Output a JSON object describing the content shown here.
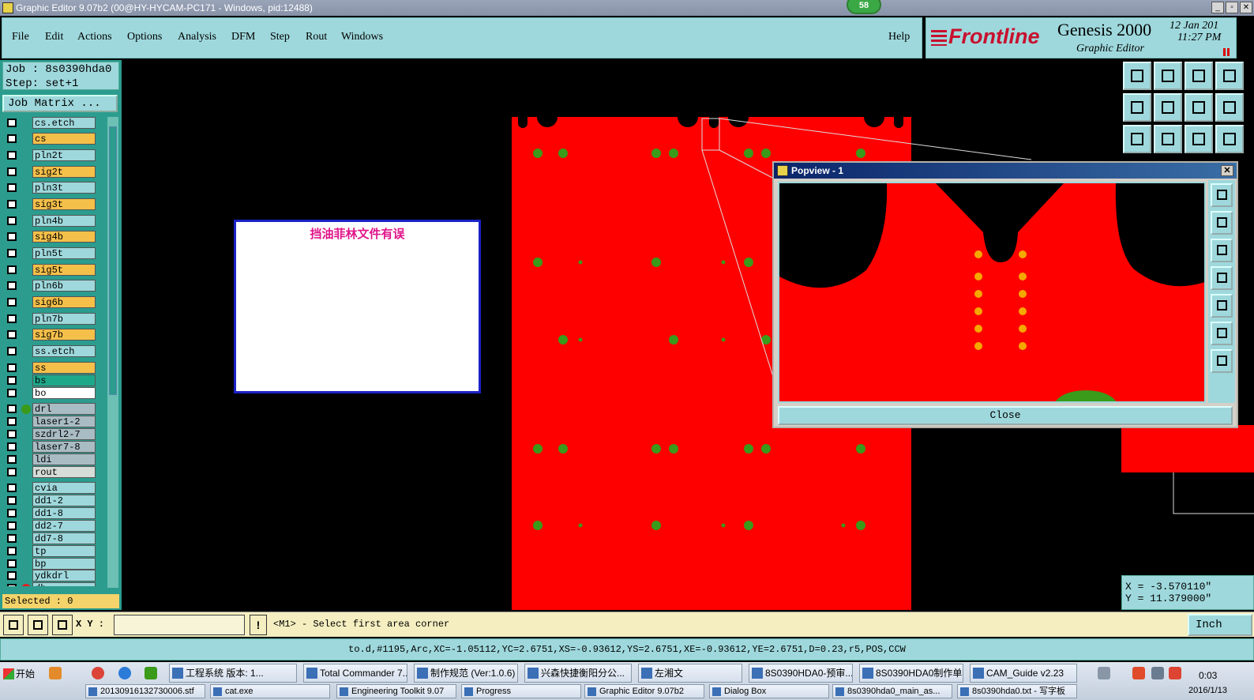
{
  "window": {
    "title": "Graphic Editor 9.07b2 (00@HY-HYCAM-PC171 - Windows, pid:12488)",
    "badge": "58"
  },
  "menu": {
    "items": [
      "File",
      "Edit",
      "Actions",
      "Options",
      "Analysis",
      "DFM",
      "Step",
      "Rout",
      "Windows"
    ],
    "help": "Help"
  },
  "brand": {
    "logo": "Frontline",
    "product": "Genesis 2000",
    "subtitle": "Graphic Editor",
    "date": "12 Jan 201",
    "time": "11:27 PM"
  },
  "job": {
    "job_line": "Job : 8s0390hda0",
    "step_line": "Step: set+1",
    "matrix_button": "Job Matrix ..."
  },
  "layers": [
    {
      "name": "cs.etch",
      "color": "#9ed8dc"
    },
    {
      "name": "cs",
      "color": "#f5c04a"
    },
    {
      "name": "pln2t",
      "color": "#9ed8dc"
    },
    {
      "name": "sig2t",
      "color": "#f5c04a"
    },
    {
      "name": "pln3t",
      "color": "#9ed8dc"
    },
    {
      "name": "sig3t",
      "color": "#f5c04a"
    },
    {
      "name": "pln4b",
      "color": "#9ed8dc"
    },
    {
      "name": "sig4b",
      "color": "#f5c04a"
    },
    {
      "name": "pln5t",
      "color": "#9ed8dc"
    },
    {
      "name": "sig5t",
      "color": "#f5c04a"
    },
    {
      "name": "pln6b",
      "color": "#9ed8dc"
    },
    {
      "name": "sig6b",
      "color": "#f5c04a"
    },
    {
      "name": "pln7b",
      "color": "#9ed8dc"
    },
    {
      "name": "sig7b",
      "color": "#f5c04a"
    },
    {
      "name": "ss.etch",
      "color": "#9ed8dc"
    },
    {
      "name": "ss",
      "color": "#f5c04a"
    },
    {
      "name": "bs",
      "color": "#1ea88a"
    },
    {
      "name": "bo",
      "color": "#ffffff"
    },
    {
      "name": "drl",
      "color": "#a9bcc4"
    },
    {
      "name": "laser1-2",
      "color": "#a9bcc4"
    },
    {
      "name": "szdrl2-7",
      "color": "#a9bcc4"
    },
    {
      "name": "laser7-8",
      "color": "#a9bcc4"
    },
    {
      "name": "ldi",
      "color": "#a9bcc4"
    },
    {
      "name": "rout",
      "color": "#d6dcd8"
    },
    {
      "name": "cvia",
      "color": "#9ed8dc"
    },
    {
      "name": "dd1-2",
      "color": "#9ed8dc"
    },
    {
      "name": "dd1-8",
      "color": "#9ed8dc"
    },
    {
      "name": "dd2-7",
      "color": "#9ed8dc"
    },
    {
      "name": "dd7-8",
      "color": "#9ed8dc"
    },
    {
      "name": "tp",
      "color": "#9ed8dc"
    },
    {
      "name": "bp",
      "color": "#9ed8dc"
    },
    {
      "name": "ydkdrl",
      "color": "#9ed8dc"
    },
    {
      "name": "dh",
      "color": "#9ed8dc"
    }
  ],
  "selected": "Selected : 0",
  "note": "挡油菲林文件有误",
  "coords": {
    "x": "X = -3.570110\"",
    "y": "Y = 11.379000\""
  },
  "popview": {
    "title": "Popview - 1",
    "close_button": "Close"
  },
  "cmd": {
    "xy_label": "X Y :",
    "bang": "!",
    "prompt": "<M1> - Select first area corner",
    "unit_button": "Inch"
  },
  "status": "to.d,#1195,Arc,XC=-1.05112,YC=2.6751,XS=-0.93612,YS=2.6751,XE=-0.93612,YE=2.6751,D=0.23,r5,POS,CCW",
  "taskbar": {
    "start": "开始",
    "tasks": [
      "工程系统  版本: 1...",
      "Total Commander 7....",
      "制作规范 (Ver:1.0.6)",
      "兴森快捷衡阳分公...",
      "左湘文",
      "8S0390HDA0-预审...",
      "8S0390HDA0制作单...",
      "CAM_Guide v2.23"
    ],
    "tasks_row2": [
      "20130916132730006.stf",
      "cat.exe",
      "Engineering Toolkit 9.07",
      "Progress",
      "Graphic Editor 9.07b2",
      "Dialog Box",
      "8s0390hda0_main_as...",
      "8s0390hda0.txt - 写字板"
    ],
    "time": "0:03",
    "date": "2016/1/13"
  },
  "colors": {
    "board": "#fe0000",
    "pad": "#3a9a1a",
    "panel": "#9ed8dc",
    "accent": "#2b9c8e"
  }
}
